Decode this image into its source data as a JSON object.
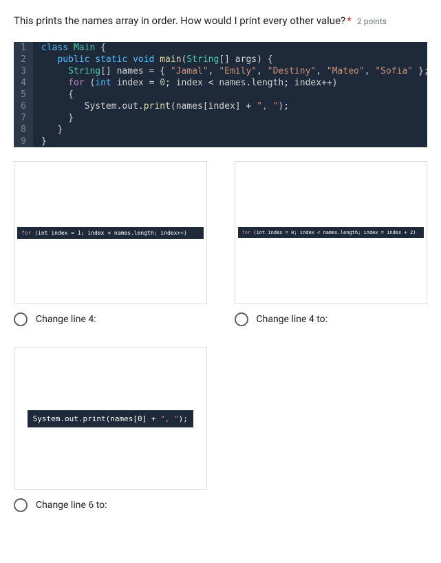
{
  "question": {
    "text": "This prints the names array in order. How would I print every other value?",
    "required": "*",
    "points": "2 points"
  },
  "code": {
    "lines": [
      {
        "num": "1"
      },
      {
        "num": "2"
      },
      {
        "num": "3"
      },
      {
        "num": "4"
      },
      {
        "num": "5"
      },
      {
        "num": "6"
      },
      {
        "num": "7"
      },
      {
        "num": "8"
      },
      {
        "num": "9"
      }
    ]
  },
  "options": {
    "a": {
      "label": "Change line 4:",
      "snippet": "for (int index = 1; index < names.length; index++)"
    },
    "b": {
      "label": "Change line 4 to:",
      "snippet": "for (int index = 0; index < names.length; index = index + 2)"
    },
    "c": {
      "label": "Change line 6 to:",
      "snippet_pre": "System.out.print(names[0] + ",
      "snippet_str": "\", \"",
      "snippet_post": ");"
    }
  }
}
